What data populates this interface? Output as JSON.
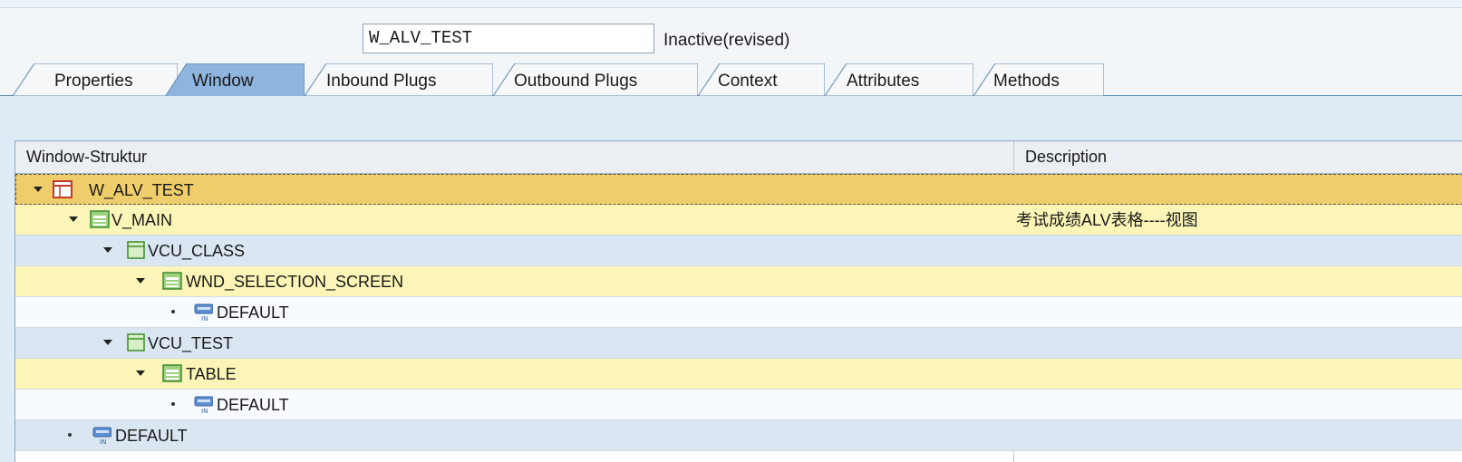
{
  "header": {
    "name_value": "W_ALV_TEST",
    "status": "Inactive(revised)"
  },
  "tabs": [
    {
      "label": "Properties",
      "active": false
    },
    {
      "label": "Window",
      "active": true
    },
    {
      "label": "Inbound Plugs",
      "active": false
    },
    {
      "label": "Outbound Plugs",
      "active": false
    },
    {
      "label": "Context",
      "active": false
    },
    {
      "label": "Attributes",
      "active": false
    },
    {
      "label": "Methods",
      "active": false
    }
  ],
  "tree": {
    "columns": [
      "Window-Struktur",
      "Description"
    ],
    "rows": [
      {
        "label": "W_ALV_TEST",
        "description": "",
        "icon": "window-icon",
        "expanded": true,
        "selected": true
      },
      {
        "label": "V_MAIN",
        "description": "考试成绩ALV表格----视图",
        "icon": "view-icon",
        "expanded": true
      },
      {
        "label": "VCU_CLASS",
        "description": "",
        "icon": "view-container-icon",
        "expanded": true
      },
      {
        "label": "WND_SELECTION_SCREEN",
        "description": "",
        "icon": "view-icon",
        "expanded": true
      },
      {
        "label": "DEFAULT",
        "description": "",
        "icon": "inbound-plug-icon",
        "leaf": true
      },
      {
        "label": "VCU_TEST",
        "description": "",
        "icon": "view-container-icon",
        "expanded": true
      },
      {
        "label": "TABLE",
        "description": "",
        "icon": "view-icon",
        "expanded": true
      },
      {
        "label": "DEFAULT",
        "description": "",
        "icon": "inbound-plug-icon",
        "leaf": true
      },
      {
        "label": "DEFAULT",
        "description": "",
        "icon": "inbound-plug-icon",
        "leaf": true
      }
    ]
  },
  "colors": {
    "selected_row": "#f0cd6b",
    "view_row": "#fbf6b7",
    "blue_row": "#dae6f2",
    "plug_row": "#f7fbff",
    "active_tab": "#8fb4dd",
    "inactive_tab": "#f6f8fa"
  }
}
